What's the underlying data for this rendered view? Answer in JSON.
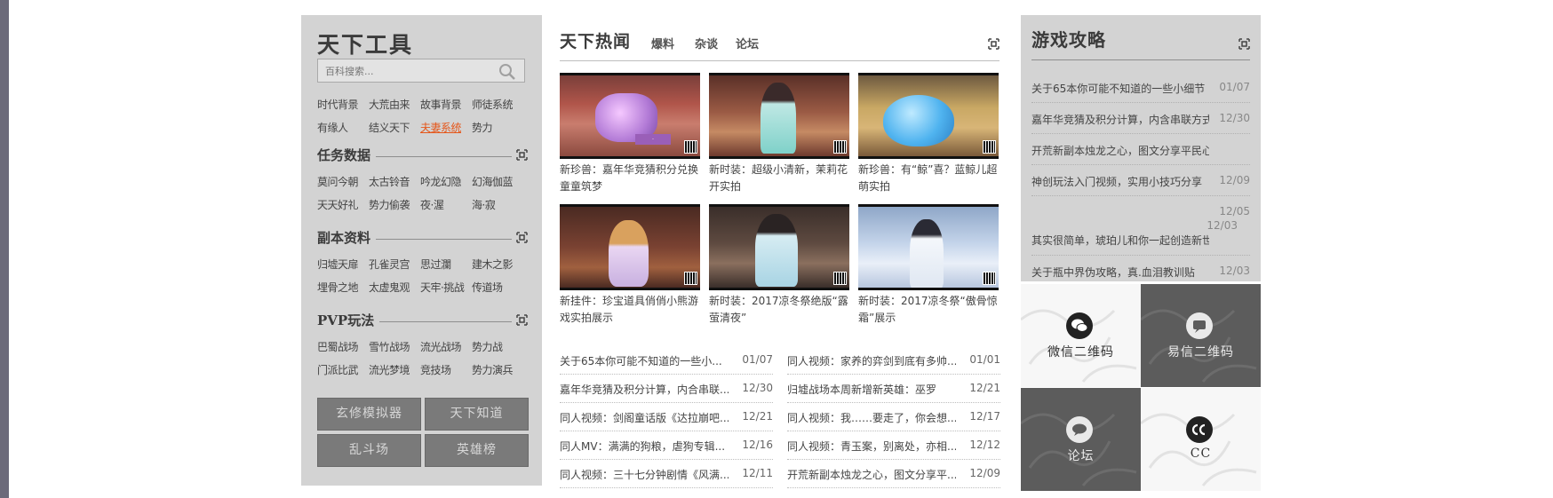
{
  "tools": {
    "title": "天下工具",
    "search_placeholder": "百科搜索...",
    "rows1": [
      [
        "时代背景",
        "大荒由来",
        "故事背景",
        "师徒系统"
      ],
      [
        "有缘人",
        "结义天下",
        "夫妻系统",
        "势力"
      ]
    ],
    "sections": [
      {
        "title": "任务数据",
        "rows": [
          [
            "莫问今朝",
            "太古铃音",
            "吟龙幻隐",
            "幻海伽蓝"
          ],
          [
            "天天好礼",
            "势力偷袭",
            "夜·渥",
            "海·寂"
          ]
        ]
      },
      {
        "title": "副本资料",
        "rows": [
          [
            "归墟天扉",
            "孔雀灵宫",
            "思过瀾",
            "建木之影"
          ],
          [
            "埋骨之地",
            "太虚鬼观",
            "天牢·挑战",
            "传道场"
          ]
        ]
      },
      {
        "title": "PVP玩法",
        "rows": [
          [
            "巴蜀战场",
            "雪竹战场",
            "流光战场",
            "势力战"
          ],
          [
            "门派比武",
            "流光梦境",
            "竞技场",
            "势力演兵"
          ]
        ]
      }
    ],
    "buttons": [
      "玄修模拟器",
      "天下知道",
      "乱斗场",
      "英雄榜"
    ]
  },
  "hot": {
    "title": "天下热闻",
    "tabs": [
      "爆料",
      "杂谈",
      "论坛"
    ],
    "thumbs": [
      "新珍兽：嘉年华竞猜积分兑换童童筑梦",
      "新时装：超级小清新，茉莉花开实拍",
      "新珍兽：有“鲸”喜？蓝鲸儿超萌实拍",
      "新挂件：珍宝道具俏俏小熊游戏实拍展示",
      "新时装：2017凉冬祭绝版“露萤清夜”",
      "新时装：2017凉冬祭“傲骨惊霜”展示"
    ],
    "news_left": [
      {
        "title": "关于65本你可能不知道的一些小...",
        "date": "01/07"
      },
      {
        "title": "嘉年华竞猜及积分计算，内合串联...",
        "date": "12/30"
      },
      {
        "title": "同人视频：剑阁童话版《达拉崩吧...",
        "date": "12/21"
      },
      {
        "title": "同人MV：满满的狗粮，虐狗专辑...",
        "date": "12/16"
      },
      {
        "title": "同人视频：三十七分钟剧情《风满...",
        "date": "12/11"
      }
    ],
    "news_right": [
      {
        "title": "同人视频：家养的弈剑到底有多帅...",
        "date": "01/01"
      },
      {
        "title": "归墟战场本周新增新英雄：巫罗",
        "date": "12/21"
      },
      {
        "title": "同人视频：我……要走了，你会想...",
        "date": "12/17"
      },
      {
        "title": "同人视频：青玉案，别离处，亦相...",
        "date": "12/12"
      },
      {
        "title": "开荒新副本烛龙之心，图文分享平...",
        "date": "12/09"
      }
    ]
  },
  "guides": {
    "title": "游戏攻略",
    "items": [
      {
        "title": "关于65本你可能不知道的一些小细节",
        "date": "01/07"
      },
      {
        "title": "嘉年华竞猜及积分计算，内含串联方式",
        "date": "12/30"
      },
      {
        "title": "开荒新副本烛龙之心，图文分享平民心得",
        "date": ""
      },
      {
        "title": "神创玩法入门视频，实用小技巧分享",
        "date": "12/09"
      }
    ],
    "tall_dates": [
      "12/05",
      "12/03"
    ],
    "tall_title": "其实很简单，琥珀儿和你一起创造新世界",
    "last": {
      "title": "关于瓶中界伪攻略，真.血泪教训贴",
      "date": "12/03"
    }
  },
  "tiles": [
    "微信二维码",
    "易信二维码",
    "论坛",
    "CC"
  ],
  "colors": {
    "accent": "#e5571b",
    "panel": "#d3d3d3",
    "outer": "#6c6a7a"
  }
}
